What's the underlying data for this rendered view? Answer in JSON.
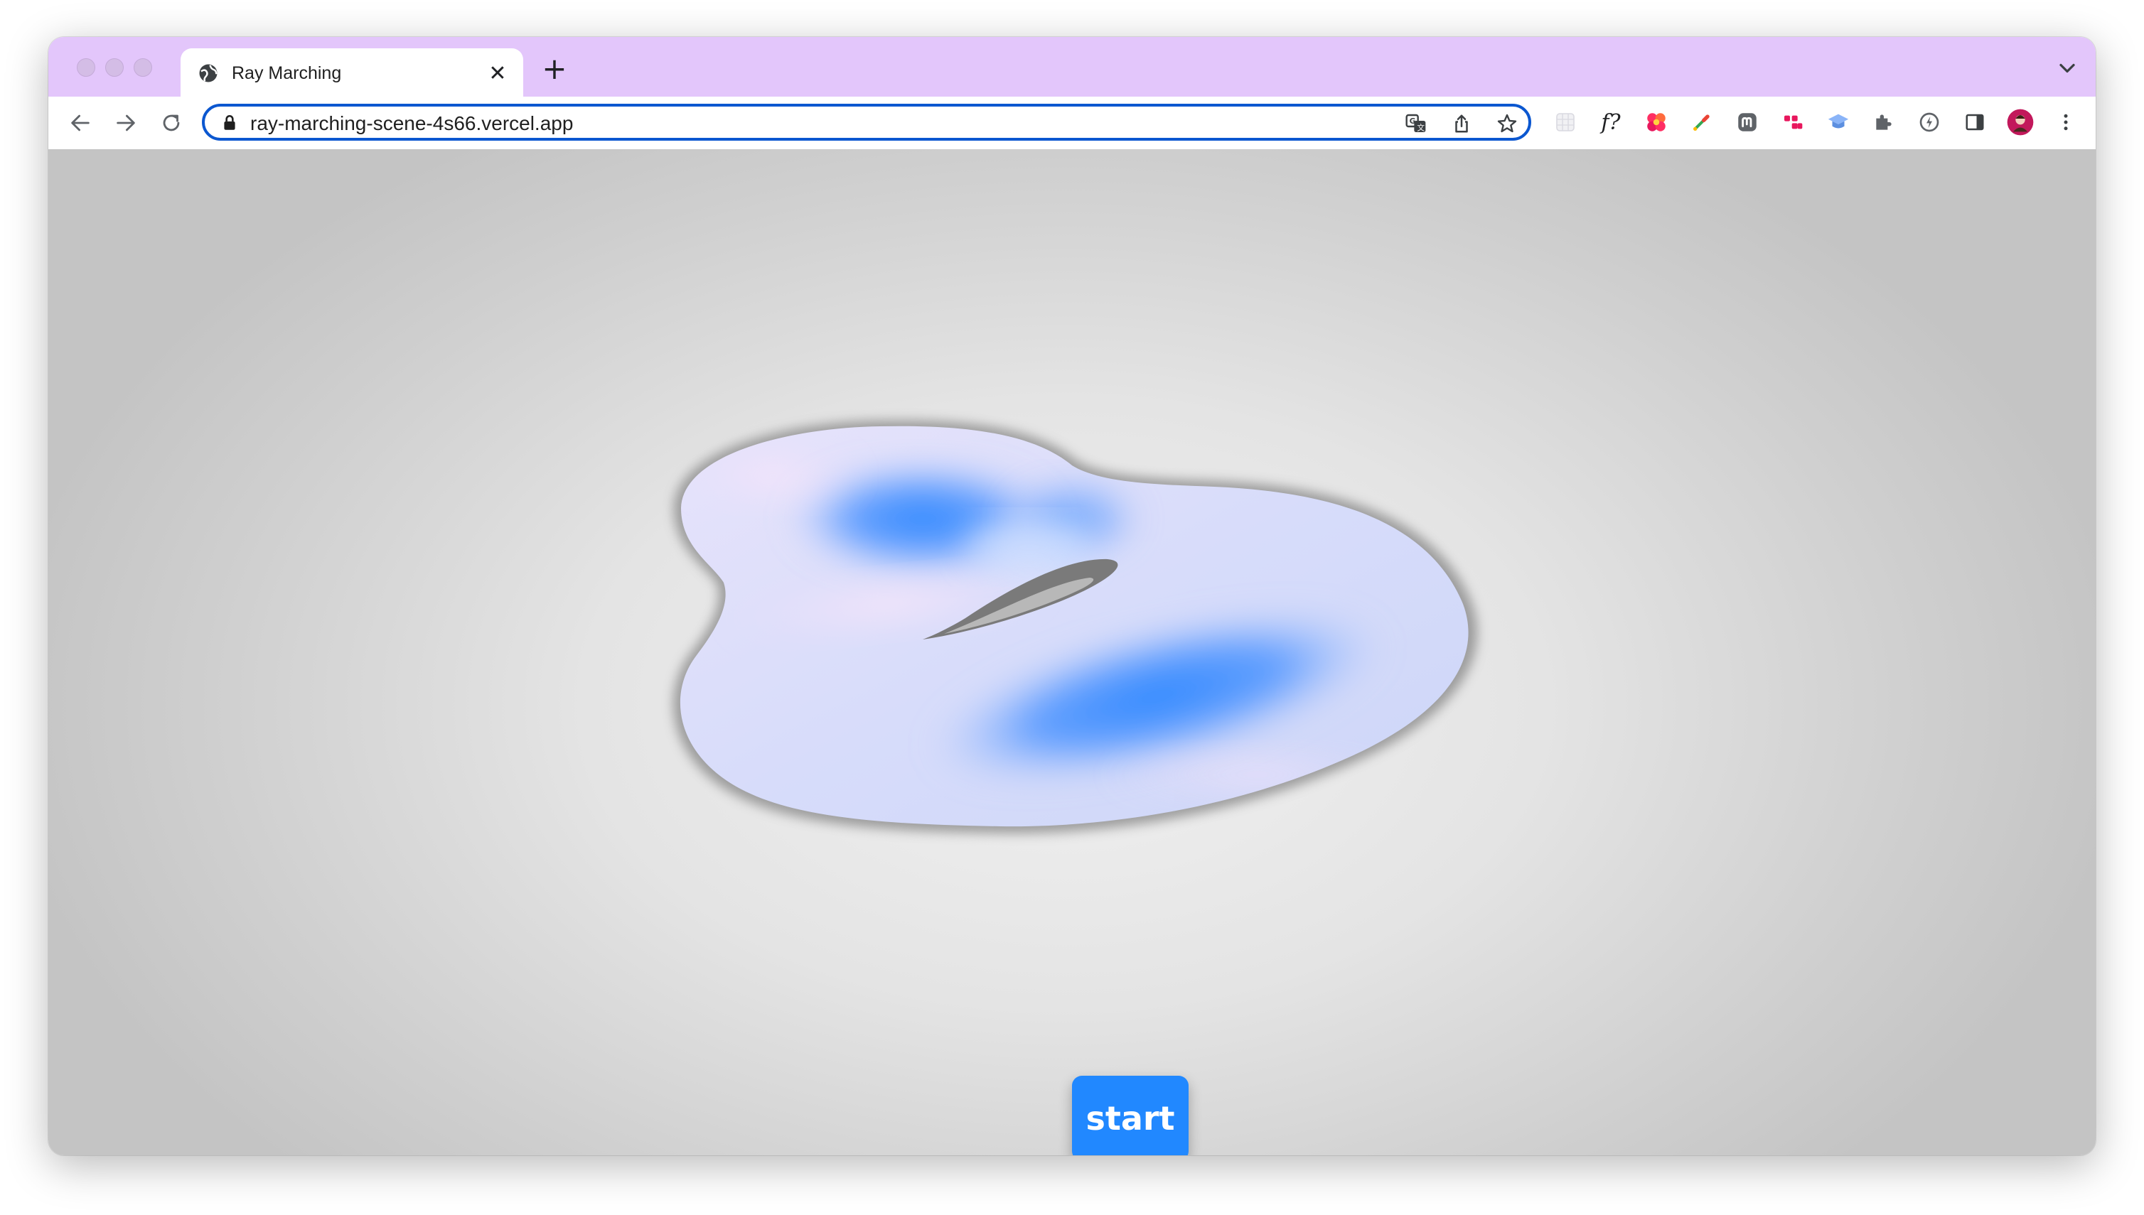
{
  "browser": {
    "tab_title": "Ray Marching",
    "tab_close_glyph": "✕",
    "new_tab_glyph": "+",
    "url": "ray-marching-scene-4s66.vercel.app",
    "tabstrip_color": "#e3c6fb",
    "omnibox_border_color": "#0b57d0",
    "extensions": [
      {
        "name": "grid-extension-icon"
      },
      {
        "name": "font-finder-extension-icon",
        "label": "f?"
      },
      {
        "name": "flower-extension-icon"
      },
      {
        "name": "color-picker-extension-icon"
      },
      {
        "name": "mastodon-extension-icon"
      },
      {
        "name": "dots-extension-icon"
      },
      {
        "name": "graduation-cap-extension-icon"
      },
      {
        "name": "puzzle-extensions-icon"
      },
      {
        "name": "lightning-extension-icon"
      },
      {
        "name": "side-panel-icon"
      },
      {
        "name": "profile-avatar"
      },
      {
        "name": "more-menu-icon"
      }
    ]
  },
  "page": {
    "start_label": "start",
    "accent_color": "#2188ff"
  }
}
